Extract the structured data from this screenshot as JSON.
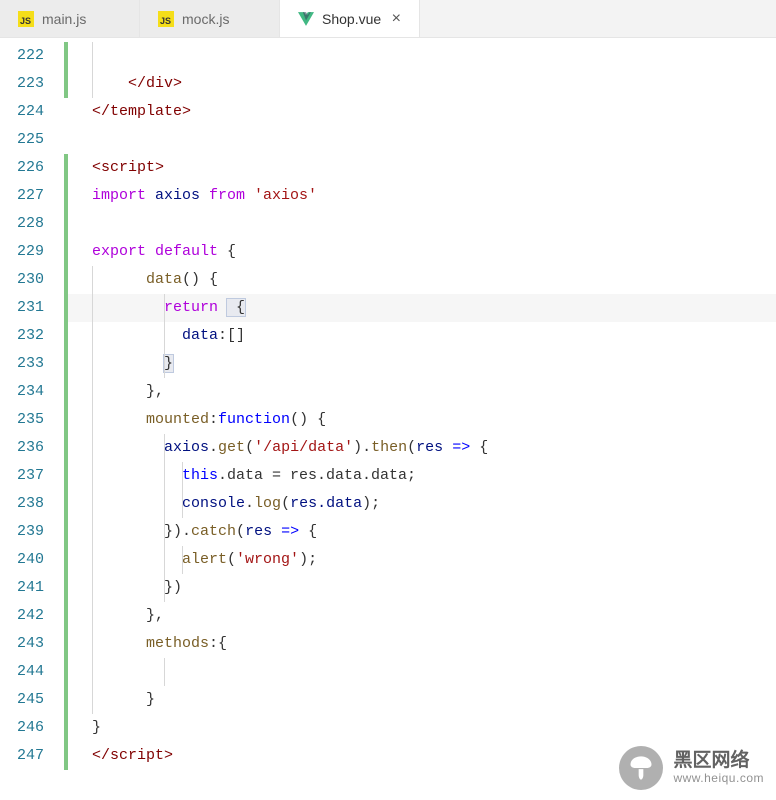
{
  "tabs": [
    {
      "label": "main.js",
      "type": "js",
      "active": false
    },
    {
      "label": "mock.js",
      "type": "js",
      "active": false
    },
    {
      "label": "Shop.vue",
      "type": "vue",
      "active": true
    }
  ],
  "gutter": [
    "222",
    "223",
    "224",
    "225",
    "226",
    "227",
    "228",
    "229",
    "230",
    "231",
    "232",
    "233",
    "234",
    "235",
    "236",
    "237",
    "238",
    "239",
    "240",
    "241",
    "242",
    "243",
    "244",
    "245",
    "246",
    "247"
  ],
  "code": {
    "l222": "",
    "l223_indent": "    ",
    "l223_open": "</",
    "l223_tag": "div",
    "l223_close": ">",
    "l224_open": "</",
    "l224_tag": "template",
    "l224_close": ">",
    "l226_open": "<",
    "l226_tag": "script",
    "l226_close": ">",
    "l227_import": "import",
    "l227_axios": " axios ",
    "l227_from": "from",
    "l227_str": " 'axios'",
    "l229_export": "export",
    "l229_default": " default",
    "l229_brace": " {",
    "l230_pad": "      ",
    "l230_data": "data",
    "l230_paren": "()",
    "l230_brace": " {",
    "l231_pad": "        ",
    "l231_return": "return",
    "l231_brace": " {",
    "l232_pad": "          ",
    "l232_prop": "data",
    "l232_colon": ":",
    "l232_arr": "[]",
    "l233_pad": "        ",
    "l233_brace": "}",
    "l234_pad": "      ",
    "l234": "},",
    "l235_pad": "      ",
    "l235_mounted": "mounted",
    "l235_colon": ":",
    "l235_func": "function",
    "l235_paren": "()",
    "l235_brace": " {",
    "l236_pad": "        ",
    "l236_axios": "axios",
    "l236_dot1": ".",
    "l236_get": "get",
    "l236_p1": "(",
    "l236_str": "'/api/data'",
    "l236_p2": ")",
    "l236_dot2": ".",
    "l236_then": "then",
    "l236_p3": "(",
    "l236_res": "res",
    "l236_arrow": " => ",
    "l236_brace": "{",
    "l237_pad": "          ",
    "l237_this": "this",
    "l237_rest": ".data = res.data.data;",
    "l238_pad": "          ",
    "l238_console": "console",
    "l238_dot": ".",
    "l238_log": "log",
    "l238_p1": "(",
    "l238_arg": "res.data",
    "l238_p2": ");",
    "l239_pad": "        ",
    "l239_close": "}).",
    "l239_catch": "catch",
    "l239_p1": "(",
    "l239_res": "res",
    "l239_arrow": " => ",
    "l239_brace": "{",
    "l240_pad": "          ",
    "l240_alert": "alert",
    "l240_p1": "(",
    "l240_str": "'wrong'",
    "l240_p2": ");",
    "l241_pad": "        ",
    "l241": "})",
    "l242_pad": "      ",
    "l242": "},",
    "l243_pad": "      ",
    "l243_methods": "methods",
    "l243_rest": ":{",
    "l245_pad": "      ",
    "l245": "}",
    "l246": "}",
    "l247_open": "</",
    "l247_tag": "script",
    "l247_close": ">"
  },
  "watermark": {
    "title": "黑区网络",
    "url": "www.heiqu.com"
  }
}
